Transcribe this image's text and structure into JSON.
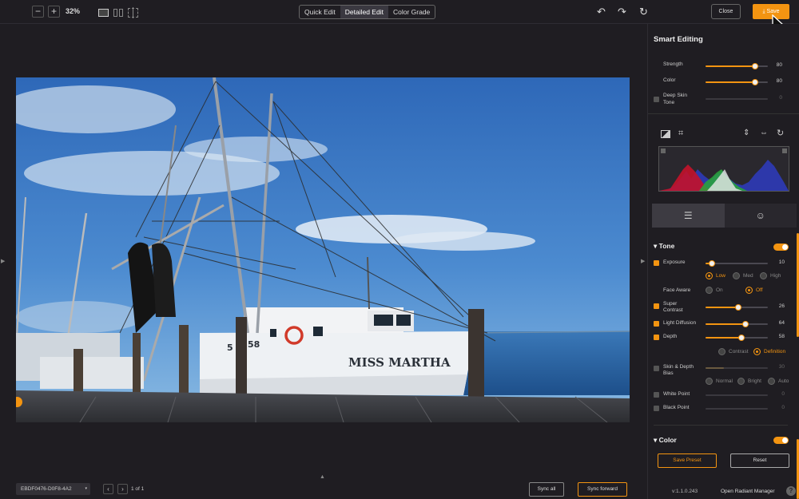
{
  "toolbar": {
    "zoom_out": "−",
    "zoom_in": "+",
    "zoom_level": "32%",
    "modes": [
      "Quick Edit",
      "Detailed Edit",
      "Color Grade"
    ],
    "active_mode": "Detailed Edit",
    "close_label": "Close",
    "save_label": "Save"
  },
  "viewer": {
    "boat_name": "MISS MARTHA",
    "hull_number": "58",
    "hull_prefix": "5",
    "filename": "EBDF0476-D0F8-4A2",
    "page_info": "1 of 1",
    "sync_all": "Sync all",
    "sync_forward": "Sync forward"
  },
  "panel": {
    "title": "Smart Editing",
    "smart": [
      {
        "label": "Strength",
        "value": "80",
        "level": 80
      },
      {
        "label": "Color",
        "value": "80",
        "level": 80
      },
      {
        "label": "Deep Skin",
        "label2": "Tone",
        "value": "0",
        "level": 0
      }
    ],
    "tone": {
      "title": "Tone",
      "exposure": {
        "label": "Exposure",
        "value": "10",
        "level": 10
      },
      "exposure_opts": [
        "Low",
        "Med",
        "High"
      ],
      "face_aware": {
        "label": "Face Aware",
        "opts": [
          "On",
          "Off"
        ]
      },
      "super_contrast": {
        "label": "Super",
        "label2": "Contrast",
        "value": "26",
        "level": 52
      },
      "light_diffusion": {
        "label": "Light Diffusion",
        "value": "64",
        "level": 64
      },
      "depth": {
        "label": "Depth",
        "value": "58",
        "level": 58
      },
      "depth_opts": [
        "Contrast",
        "Definition"
      ],
      "skin_depth": {
        "label": "Skin & Depth",
        "label2": "Bias",
        "value": "30",
        "level": 30
      },
      "skin_opts": [
        "Normal",
        "Bright",
        "Auto"
      ],
      "white_point": {
        "label": "White Point",
        "value": "0",
        "level": 0
      },
      "black_point": {
        "label": "Black Point",
        "value": "0",
        "level": 0
      }
    },
    "color_section": "Color",
    "save_preset": "Save Preset",
    "reset": "Reset",
    "version": "v:1.1.0.243",
    "radiant_manager": "Open Radiant Manager",
    "help": "?"
  },
  "colors": {
    "accent": "#f39411",
    "bg": "#1f1d22"
  }
}
